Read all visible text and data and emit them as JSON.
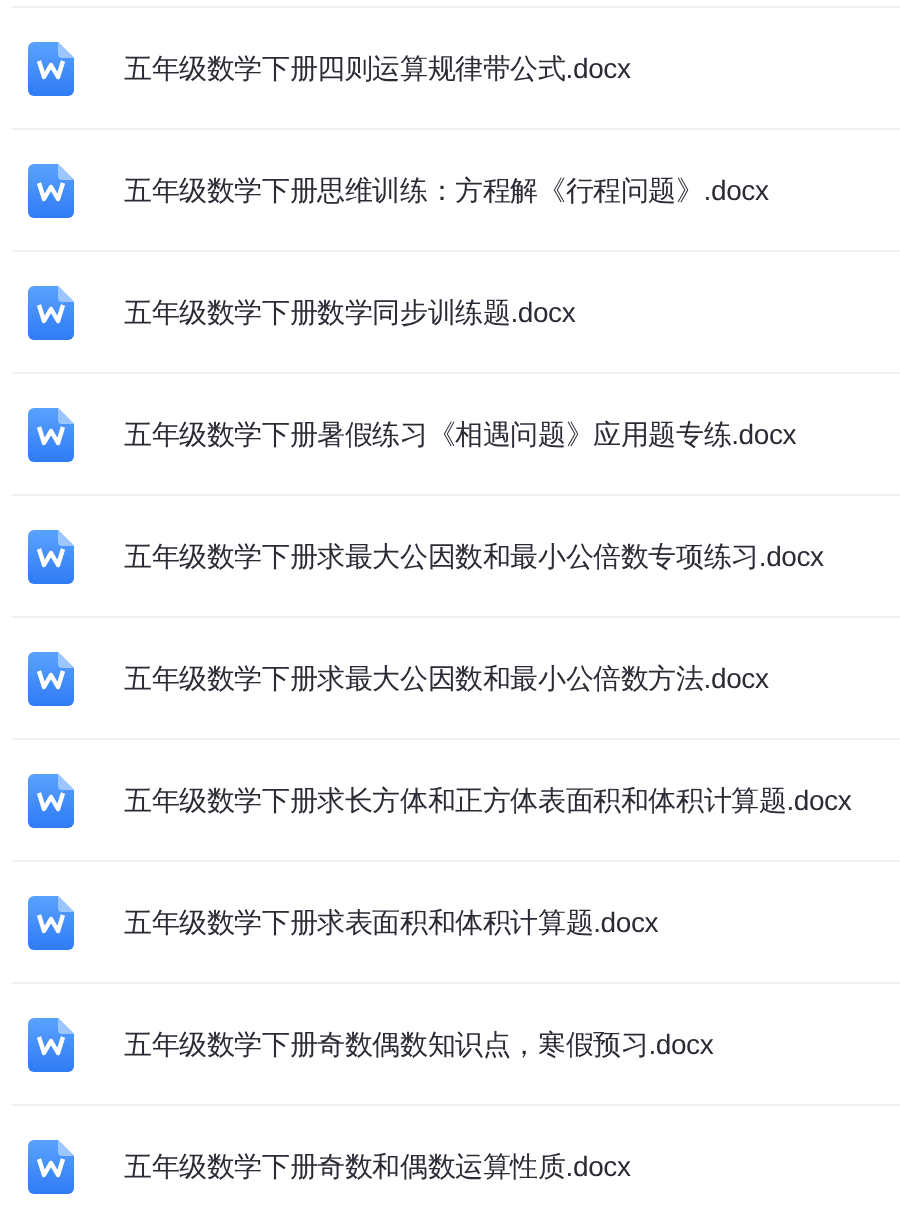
{
  "files": [
    {
      "name": "五年级数学下册四则运算规律带公式.docx"
    },
    {
      "name": "五年级数学下册思维训练：方程解《行程问题》.docx"
    },
    {
      "name": "五年级数学下册数学同步训练题.docx"
    },
    {
      "name": "五年级数学下册暑假练习《相遇问题》应用题专练.docx"
    },
    {
      "name": "五年级数学下册求最大公因数和最小公倍数专项练习.docx"
    },
    {
      "name": "五年级数学下册求最大公因数和最小公倍数方法.docx"
    },
    {
      "name": "五年级数学下册求长方体和正方体表面积和体积计算题.docx"
    },
    {
      "name": "五年级数学下册求表面积和体积计算题.docx"
    },
    {
      "name": "五年级数学下册奇数偶数知识点，寒假预习.docx"
    },
    {
      "name": "五年级数学下册奇数和偶数运算性质.docx"
    }
  ]
}
